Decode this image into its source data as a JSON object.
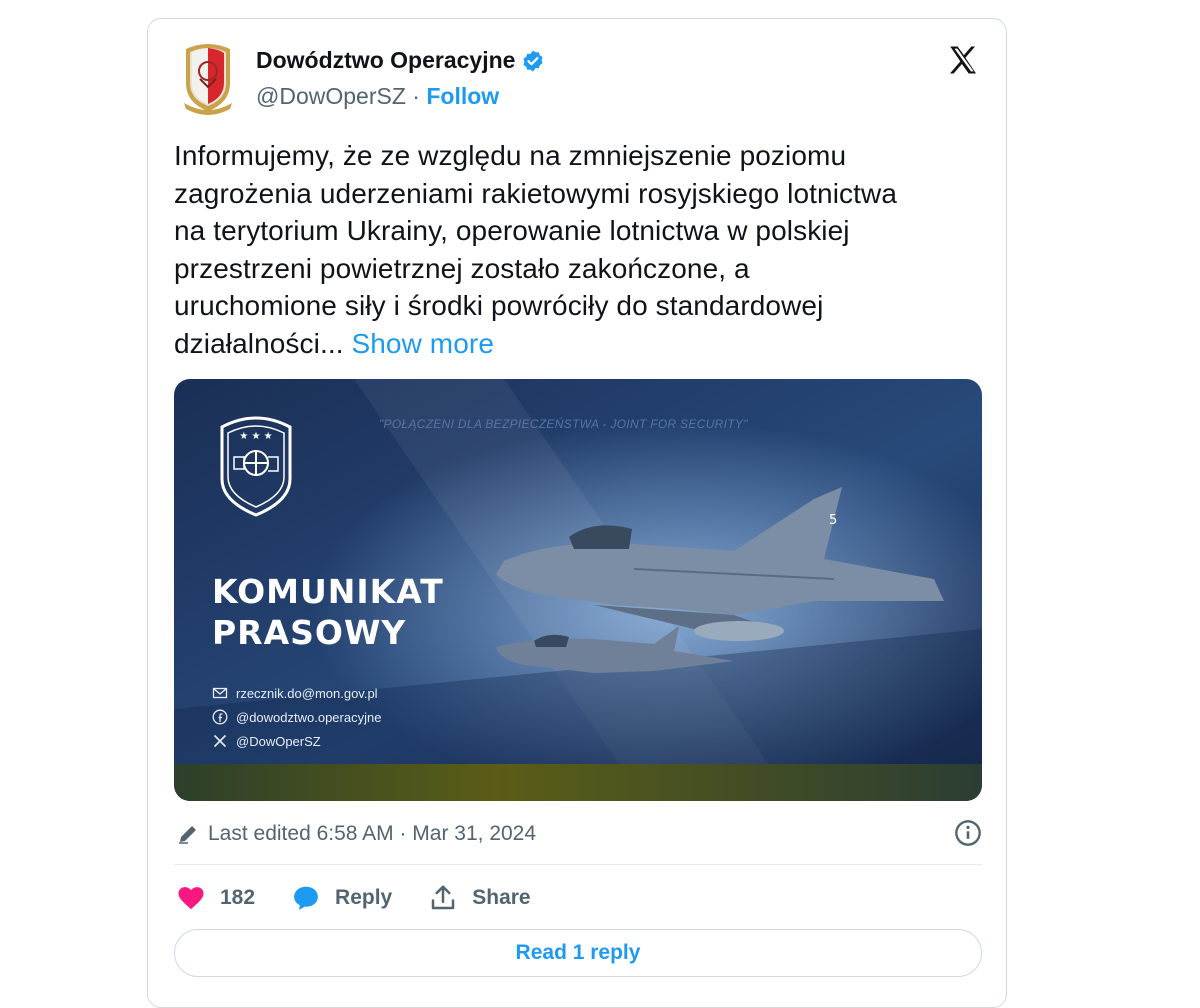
{
  "author": {
    "name": "Dowództwo Operacyjne",
    "handle": "@DowOperSZ",
    "separator": "·",
    "follow_label": "Follow"
  },
  "tweet": {
    "lines": [
      "Informujemy, że ze względu na zmniejszenie poziomu",
      "zagrożenia uderzeniami rakietowymi rosyjskiego lotnictwa",
      "na terytorium Ukrainy, operowanie lotnictwa w polskiej",
      "przestrzeni powietrznej zostało zakończone, a",
      "uruchomione siły i środki powróciły do standardowej",
      "działalności..."
    ],
    "show_more": "Show more"
  },
  "media": {
    "motto": "\"POŁĄCZENI DLA BEZPIECZEŃSTWA - JOINT FOR SECURITY\"",
    "title_line1": "KOMUNIKAT",
    "title_line2": "PRASOWY",
    "contacts": {
      "email": "rzecznik.do@mon.gov.pl",
      "facebook": "@dowodztwo.operacyjne",
      "x": "@DowOperSZ"
    },
    "tail_number": "5"
  },
  "meta": {
    "edited": "Last edited 6:58 AM · Mar 31, 2024"
  },
  "actions": {
    "like_count": "182",
    "reply_label": "Reply",
    "share_label": "Share",
    "read_replies": "Read 1 reply"
  },
  "colors": {
    "accent": "#1d9bf0",
    "like": "#f91880",
    "text": "#0f1419",
    "muted": "#536471",
    "banner_dark": "#1c355e",
    "banner_yellow": "#5a5a10"
  },
  "icons": [
    "verified-badge-icon",
    "x-logo-icon",
    "pencil-icon",
    "info-icon",
    "heart-icon",
    "reply-bubble-icon",
    "share-icon",
    "mail-icon",
    "facebook-icon",
    "x-small-icon"
  ]
}
